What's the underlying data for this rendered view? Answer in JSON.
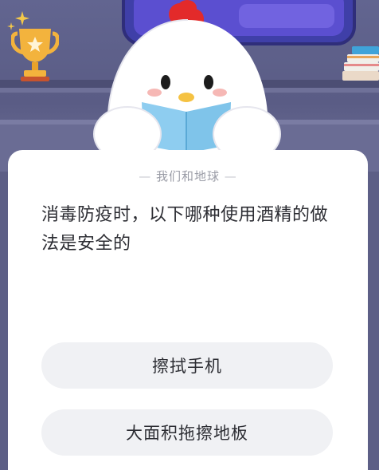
{
  "quiz": {
    "category": "我们和地球",
    "question": "消毒防疫时，以下哪种使用酒精的做法是安全的",
    "options": [
      "擦拭手机",
      "大面积拖擦地板"
    ]
  },
  "colors": {
    "background": "#5d5f86",
    "card": "#ffffff",
    "option_bg": "#f0f1f4",
    "trophy": "#f3b33d",
    "comb": "#e32a2a",
    "book": "#7fc4ea"
  },
  "icons": [
    "trophy-icon",
    "sparkle-icon",
    "chick-mascot",
    "book-stack-icon"
  ]
}
